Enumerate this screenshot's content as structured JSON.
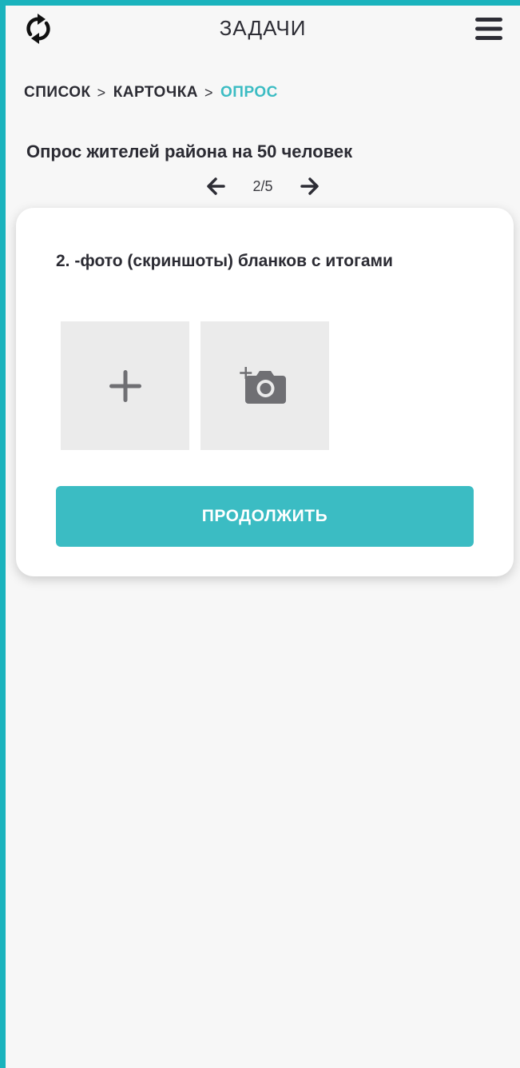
{
  "header": {
    "title": "ЗАДАЧИ",
    "refresh_icon": "refresh-icon",
    "menu_icon": "hamburger-menu-icon"
  },
  "breadcrumb": {
    "items": [
      {
        "label": "СПИСОК"
      },
      {
        "label": "КАРТОЧКА"
      },
      {
        "label": "ОПРОС"
      }
    ],
    "separator": ">"
  },
  "survey": {
    "title": "Опрос жителей района на 50 человек",
    "pager": {
      "current": 2,
      "total": 5,
      "label": "2/5"
    }
  },
  "card": {
    "question": "2. -фото (скриншоты) бланков с итогами",
    "upload_tiles": [
      {
        "icon": "plus-icon"
      },
      {
        "icon": "add-photo-camera-icon"
      }
    ],
    "continue_label": "ПРОДОЛЖИТЬ"
  },
  "colors": {
    "accent": "#3bbcc3",
    "frame": "#1ab3bd",
    "background": "#f7f7f7",
    "tile": "#ebebeb",
    "icon_gray": "#6f6f73"
  }
}
